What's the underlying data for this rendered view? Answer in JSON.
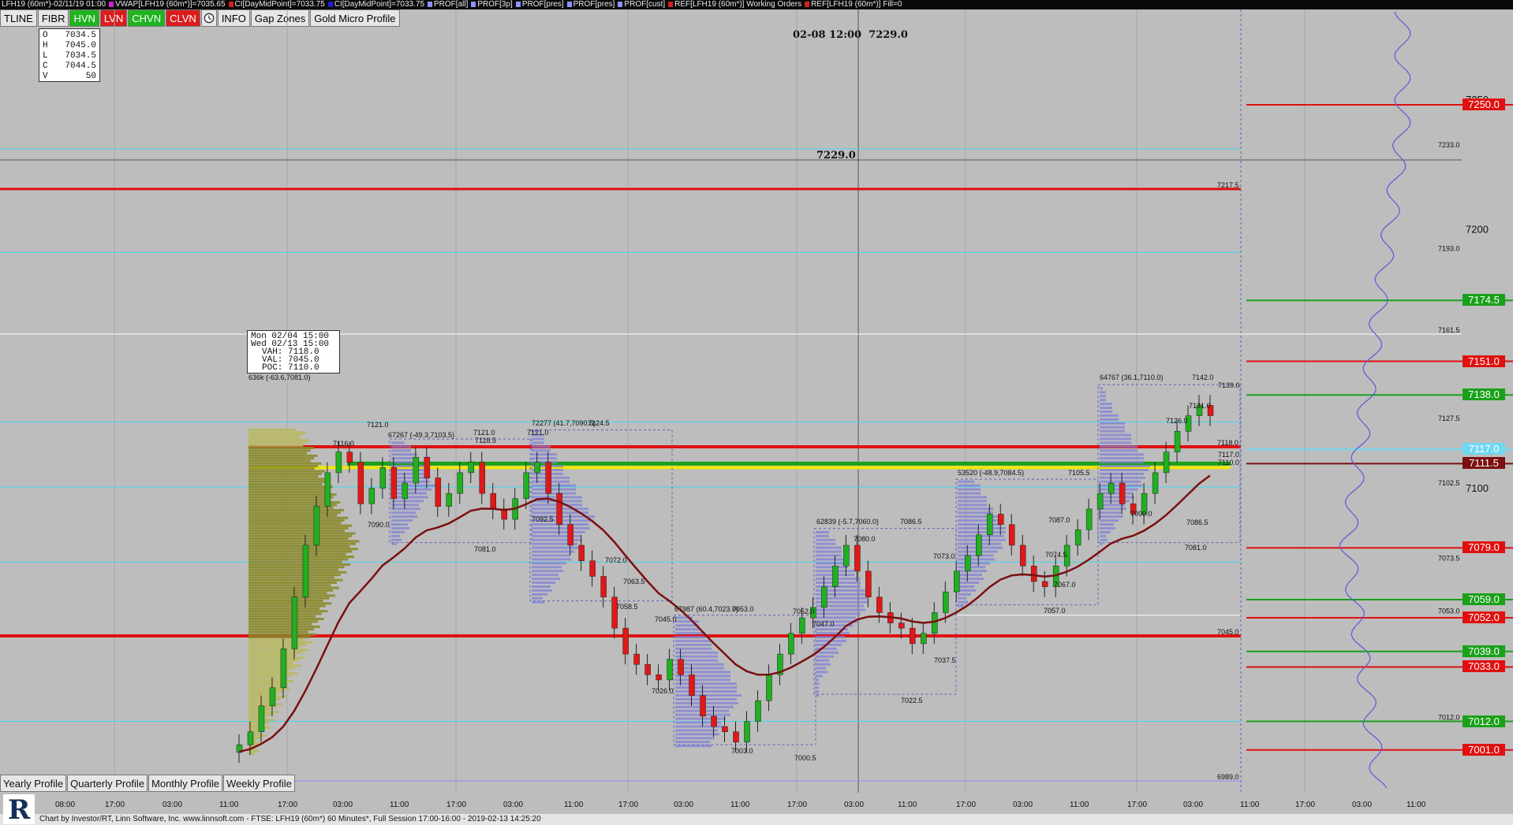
{
  "title_bar": {
    "items": [
      {
        "text": "LFH19 (60m*)-02/11/19 01:00",
        "color": "#e8e8e8"
      },
      {
        "text": "VWAP[LFH19 (60m*)]=7035.65",
        "color": "#d020d0"
      },
      {
        "text": "CI[DayMidPoint]=7033.75",
        "color": "#d02020"
      },
      {
        "text": "CI[DayMidPoint]=7033.75",
        "color": "#2020d0"
      },
      {
        "text": "PROF[all]",
        "color": "#9090ff"
      },
      {
        "text": "PROF[3p]",
        "color": "#9090ff"
      },
      {
        "text": "PROF[pres]",
        "color": "#9090ff"
      },
      {
        "text": "PROF[pres]",
        "color": "#9090ff"
      },
      {
        "text": "PROF[cust]",
        "color": "#9090ff"
      },
      {
        "text": "REF[LFH19 (60m*)] Working Orders",
        "color": "#d02020"
      },
      {
        "text": "REF[LFH19 (60m*)] Fill=0",
        "color": "#d02020"
      }
    ]
  },
  "toolbar": {
    "buttons": [
      {
        "label": "TLINE",
        "style": "plain"
      },
      {
        "label": "FIBR",
        "style": "plain"
      },
      {
        "label": "HVN",
        "style": "green"
      },
      {
        "label": "LVN",
        "style": "red"
      },
      {
        "label": "CHVN",
        "style": "green"
      },
      {
        "label": "CLVN",
        "style": "red"
      },
      {
        "label": "",
        "style": "clock",
        "icon": "clock-icon"
      },
      {
        "label": "INFO",
        "style": "plain"
      },
      {
        "label": "Gap Zones",
        "style": "plain"
      },
      {
        "label": "Gold Micro Profile",
        "style": "plain"
      }
    ]
  },
  "ohlc_box": {
    "rows": [
      {
        "k": "O",
        "v": "7034.5"
      },
      {
        "k": "H",
        "v": "7045.0"
      },
      {
        "k": "L",
        "v": "7034.5"
      },
      {
        "k": "C",
        "v": "7044.5"
      },
      {
        "k": "V",
        "v": "50"
      }
    ]
  },
  "profile_box": {
    "lines": [
      "Mon 02/04 15:00",
      "Wed 02/13 15:00",
      "VAH: 7118.0",
      "VAL: 7045.0",
      "POC: 7110.0"
    ]
  },
  "crosshair": {
    "time_label": "02-08 12:00",
    "time_price": "7229.0",
    "price_label": "7229.0"
  },
  "price_axis": {
    "labels": [
      "7250",
      "7233.0",
      "7217.5",
      "7200",
      "7193.0",
      "7161.5",
      "7127.5",
      "7118.0",
      "7102.5",
      "7100",
      "7073.5",
      "7053.0",
      "7045.0",
      "7012.0",
      "6989.0"
    ],
    "tags": [
      {
        "text": "7250.0",
        "bg": "#e01010",
        "price": 7250
      },
      {
        "text": "7174.5",
        "bg": "#1aa01a",
        "price": 7174.5
      },
      {
        "text": "7151.0",
        "bg": "#e01010",
        "price": 7151
      },
      {
        "text": "7138.0",
        "bg": "#1aa01a",
        "price": 7138
      },
      {
        "text": "7117.0",
        "bg": "#6fd8f0",
        "price": 7117
      },
      {
        "text": "7111.5",
        "bg": "#7a1010",
        "price": 7111.5
      },
      {
        "text": "7079.0",
        "bg": "#e01010",
        "price": 7079
      },
      {
        "text": "7059.0",
        "bg": "#1aa01a",
        "price": 7059
      },
      {
        "text": "7052.0",
        "bg": "#e01010",
        "price": 7052
      },
      {
        "text": "7039.0",
        "bg": "#1aa01a",
        "price": 7039
      },
      {
        "text": "7033.0",
        "bg": "#e01010",
        "price": 7033
      },
      {
        "text": "7012.0",
        "bg": "#1aa01a",
        "price": 7012
      },
      {
        "text": "7001.0",
        "bg": "#e01010",
        "price": 7001
      }
    ]
  },
  "time_axis": {
    "labels": [
      "08:00",
      "17:00",
      "03:00",
      "11:00",
      "17:00",
      "03:00",
      "11:00",
      "17:00",
      "03:00",
      "11:00",
      "17:00",
      "03:00",
      "11:00",
      "17:00",
      "03:00",
      "11:00",
      "17:00",
      "03:00",
      "11:00",
      "17:00",
      "03:00",
      "11:00",
      "17:00",
      "03:00",
      "11:00"
    ]
  },
  "chart_labels": {
    "texts": [
      "636k (-63.6,7081.0)",
      "67267 (-49.3,7103.5)",
      "72277 (41.7,7090.5)",
      "67987 (60.4,7023.0)",
      "62839 (-5.7,7060.0)",
      "53520 (-48.9,7084.5)",
      "64767 (36.1,7110.0)",
      "7121.0",
      "7121.0",
      "7118.5",
      "7121.0",
      "7124.5",
      "7116.0",
      "7090.0",
      "7092.5",
      "7081.0",
      "7072.0",
      "7063.5",
      "7058.5",
      "7045.0",
      "7053.0",
      "7052.0",
      "7026.0",
      "7003.0",
      "7000.5",
      "7086.5",
      "7080.0",
      "7047.0",
      "7073.0",
      "7037.5",
      "7022.5",
      "7105.5",
      "7087.0",
      "7074.5",
      "7067.0",
      "7057.0",
      "7142.0",
      "7139.0",
      "7131.0",
      "7126.0",
      "7117.0",
      "7110.0",
      "7090.0",
      "7086.5",
      "7081.0"
    ]
  },
  "bottom_tabs": [
    "Yearly Profile",
    "Quarterly Profile",
    "Monthly Profile",
    "Weekly Profile"
  ],
  "footer": {
    "text": "Chart by Investor/RT, Linn Software, Inc. www.linnsoft.com - FTSE: LFH19 (60m*) 60 Minutes*, Full Session 17:00-16:00 - 2019-02-13 14:25:20"
  },
  "colors": {
    "bg": "#bdbdbd",
    "red": "#e01010",
    "green": "#1aa01a",
    "cyan": "#40d8f0",
    "yellow": "#f0e800",
    "profile": "#8a8a2a",
    "vwap": "#7a1010"
  }
}
